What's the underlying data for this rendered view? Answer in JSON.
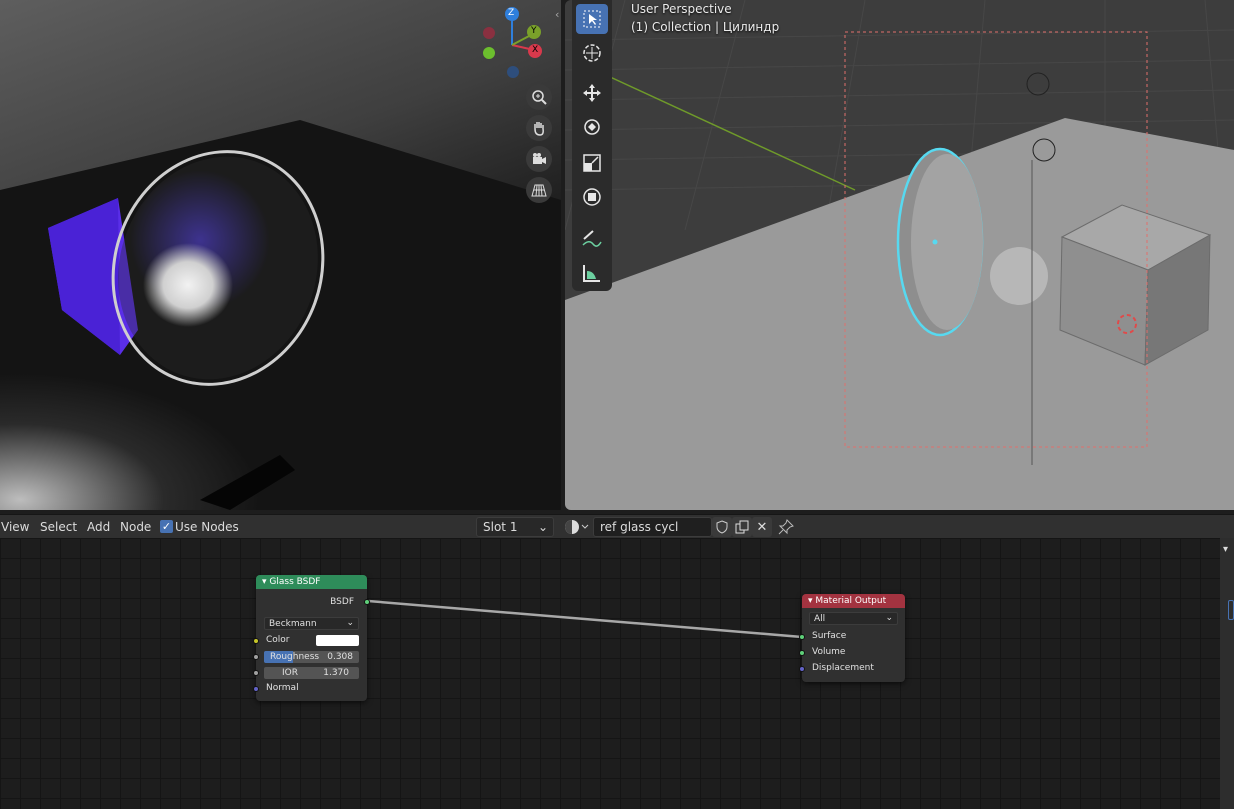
{
  "viewport": {
    "perspective_label": "User Perspective",
    "collection_label": "(1) Collection | Цилиндр",
    "gizmo": {
      "z": "Z",
      "y": "Y",
      "x": "X"
    }
  },
  "toolbar": {
    "tools": [
      "select-box-icon",
      "cursor-icon",
      "move-icon",
      "rotate-icon",
      "scale-icon",
      "transform-icon",
      "annotate-icon",
      "measure-icon"
    ]
  },
  "nav": [
    "zoom-icon",
    "hand-icon",
    "camera-icon",
    "grid-icon"
  ],
  "node_header": {
    "menu_view": "View",
    "menu_select": "Select",
    "menu_add": "Add",
    "menu_node": "Node",
    "use_nodes_label": "Use Nodes",
    "use_nodes_checked": true,
    "slot": "Slot 1",
    "material_name": "ref glass cycl"
  },
  "glass_node": {
    "title": "Glass BSDF",
    "output": "BSDF",
    "distribution": "Beckmann",
    "color_label": "Color",
    "roughness_label": "Roughness",
    "roughness_value": "0.308",
    "roughness_fraction": 0.308,
    "ior_label": "IOR",
    "ior_value": "1.370",
    "normal_label": "Normal"
  },
  "output_node": {
    "title": "Material Output",
    "target": "All",
    "surface": "Surface",
    "volume": "Volume",
    "displacement": "Displacement"
  },
  "colors": {
    "glass_header": "#2e8c5a",
    "output_header": "#a33340",
    "accent": "#4772b3",
    "selection_outline": "#57d9f0"
  }
}
